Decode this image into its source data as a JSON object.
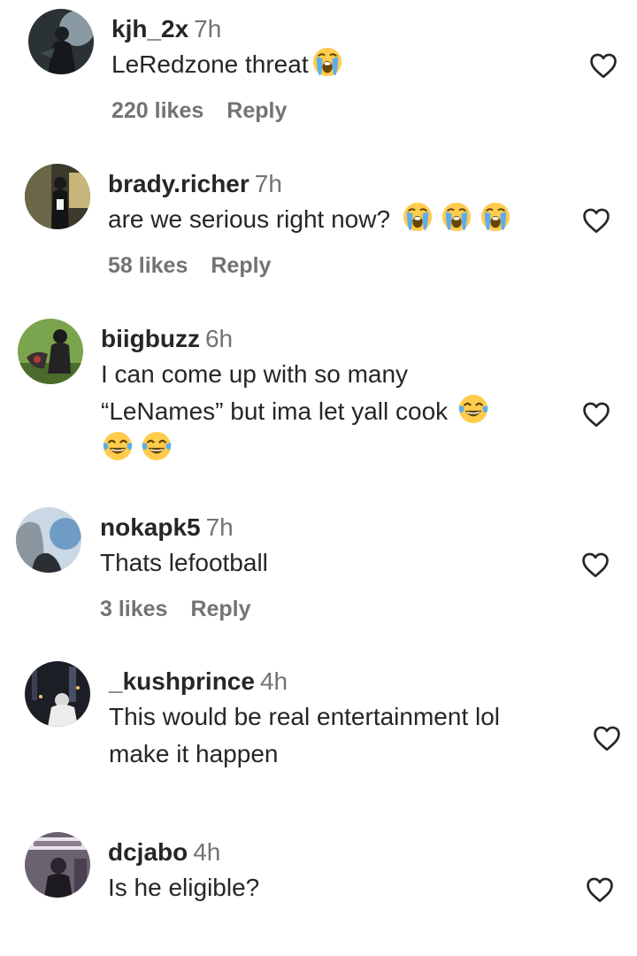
{
  "comments": [
    {
      "username": "kjh_2x",
      "time": "7h",
      "text": "LeRedzone threat",
      "emojis": [
        "loudly-crying"
      ],
      "likes": "220 likes",
      "reply": "Reply"
    },
    {
      "username": "brady.richer",
      "time": "7h",
      "text": "are we serious right now?",
      "emojis": [
        "loudly-crying",
        "loudly-crying",
        "loudly-crying"
      ],
      "likes": "58 likes",
      "reply": "Reply"
    },
    {
      "username": "biigbuzz",
      "time": "6h",
      "text_line1": "I can come up with so many",
      "text_line2": "“LeNames” but ima let yall cook",
      "emojis": [
        "tears-of-joy",
        "tears-of-joy",
        "tears-of-joy"
      ]
    },
    {
      "username": "nokapk5",
      "time": "7h",
      "text": "Thats lefootball",
      "likes": "3 likes",
      "reply": "Reply"
    },
    {
      "username": "_kushprince",
      "time": "4h",
      "text_line1": "This would be real entertainment lol",
      "text_line2": "make it happen"
    },
    {
      "username": "dcjabo",
      "time": "4h",
      "text": "Is he eligible?"
    }
  ],
  "icons": {
    "like": "heart-outline-icon",
    "crying": "loudly-crying-face-emoji",
    "laughing": "face-with-tears-of-joy-emoji"
  },
  "colors": {
    "text": "#262626",
    "muted": "#737373"
  }
}
